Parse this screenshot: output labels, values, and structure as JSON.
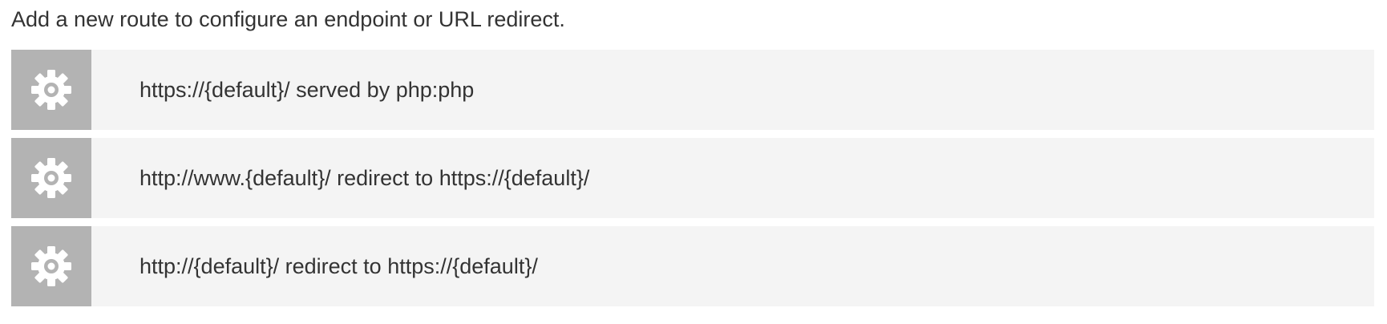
{
  "intro_text": "Add a new route to configure an endpoint or URL redirect.",
  "colors": {
    "row_background": "#f4f4f4",
    "icon_background": "#b3b3b3",
    "icon_foreground": "#ffffff",
    "text": "#333333"
  },
  "routes": [
    {
      "icon": "gear-icon",
      "label": "https://{default}/ served by php:php"
    },
    {
      "icon": "gear-icon",
      "label": "http://www.{default}/ redirect to https://{default}/"
    },
    {
      "icon": "gear-icon",
      "label": "http://{default}/ redirect to https://{default}/"
    }
  ]
}
